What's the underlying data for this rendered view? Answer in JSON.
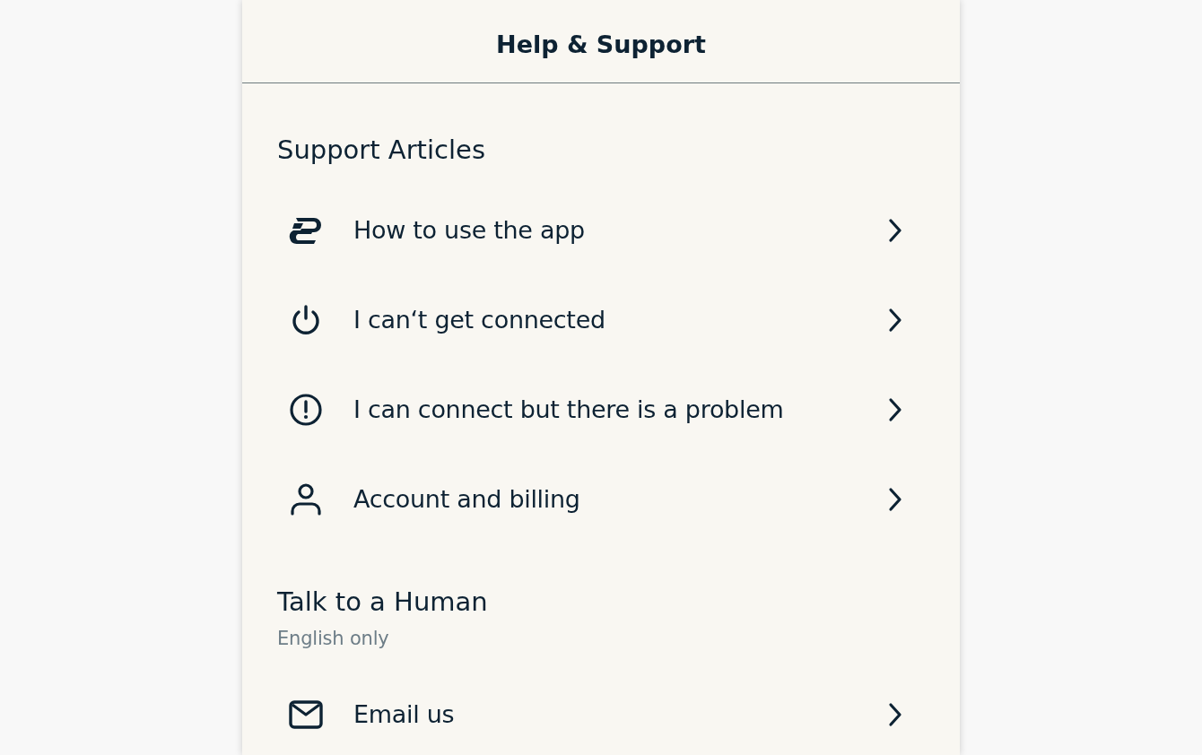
{
  "header": {
    "title": "Help & Support"
  },
  "sections": [
    {
      "heading": "Support Articles",
      "items": [
        {
          "label": "How to use the app"
        },
        {
          "label": "I can‘t get connected"
        },
        {
          "label": "I can connect but there is a problem"
        },
        {
          "label": "Account and billing"
        }
      ]
    },
    {
      "heading": "Talk to a Human",
      "subtitle": "English only",
      "items": [
        {
          "label": "Email us"
        }
      ]
    }
  ]
}
